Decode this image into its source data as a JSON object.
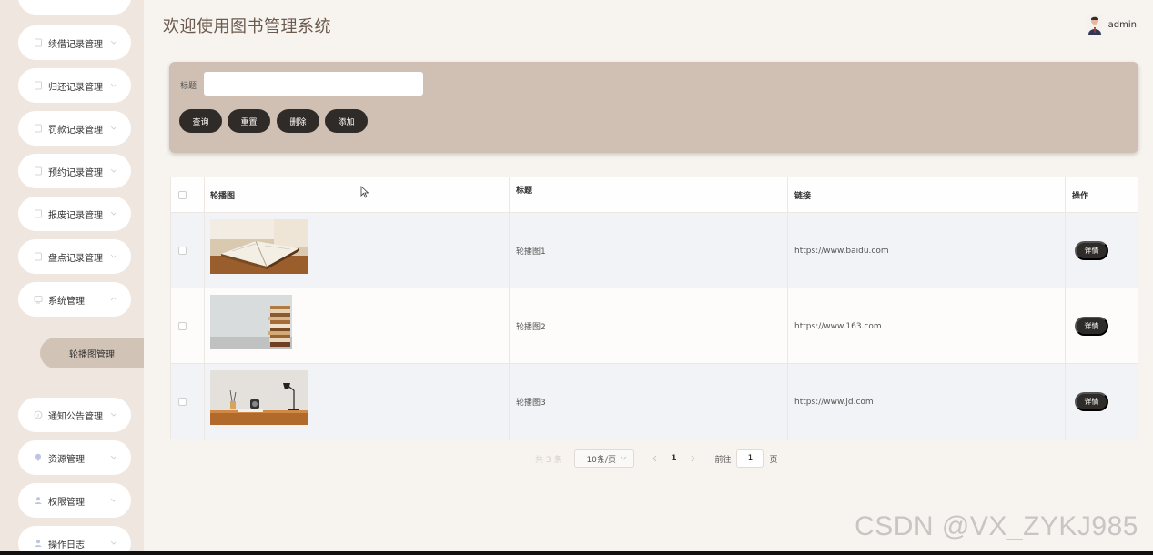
{
  "sidebar": {
    "items": [
      {
        "label": ""
      },
      {
        "label": "续借记录管理"
      },
      {
        "label": "归还记录管理"
      },
      {
        "label": "罚款记录管理"
      },
      {
        "label": "预约记录管理"
      },
      {
        "label": "报废记录管理"
      },
      {
        "label": "盘点记录管理"
      },
      {
        "label": "系统管理"
      },
      {
        "label": "通知公告管理"
      },
      {
        "label": "资源管理"
      },
      {
        "label": "权限管理"
      },
      {
        "label": "操作日志"
      }
    ],
    "active_sub": "轮播图管理"
  },
  "header": {
    "title": "欢迎使用图书管理系统",
    "user": "admin"
  },
  "search": {
    "label": "标题",
    "value": "",
    "placeholder": "",
    "buttons": {
      "query": "查询",
      "reset": "重置",
      "delete": "删除",
      "add": "添加"
    }
  },
  "table": {
    "columns": [
      "轮播图",
      "标题",
      "链接",
      "操作"
    ],
    "rows": [
      {
        "title": "轮播图1",
        "link": "https://www.baidu.com",
        "action": "详情"
      },
      {
        "title": "轮播图2",
        "link": "https://www.163.com",
        "action": "详情"
      },
      {
        "title": "轮播图3",
        "link": "https://www.jd.com",
        "action": "详情"
      }
    ]
  },
  "pagination": {
    "total": "共 3 条",
    "page_size": "10条/页",
    "current": "1",
    "goto_label": "前往",
    "goto_value": "1",
    "page_unit": "页"
  },
  "watermark": "CSDN @VX_ZYKJ985",
  "colors": {
    "sidebar_bg": "#efe6df",
    "panel_bg": "#cfc0b3",
    "button_bg": "#2f2b28",
    "active_sub_bg": "#d2c3b7"
  }
}
